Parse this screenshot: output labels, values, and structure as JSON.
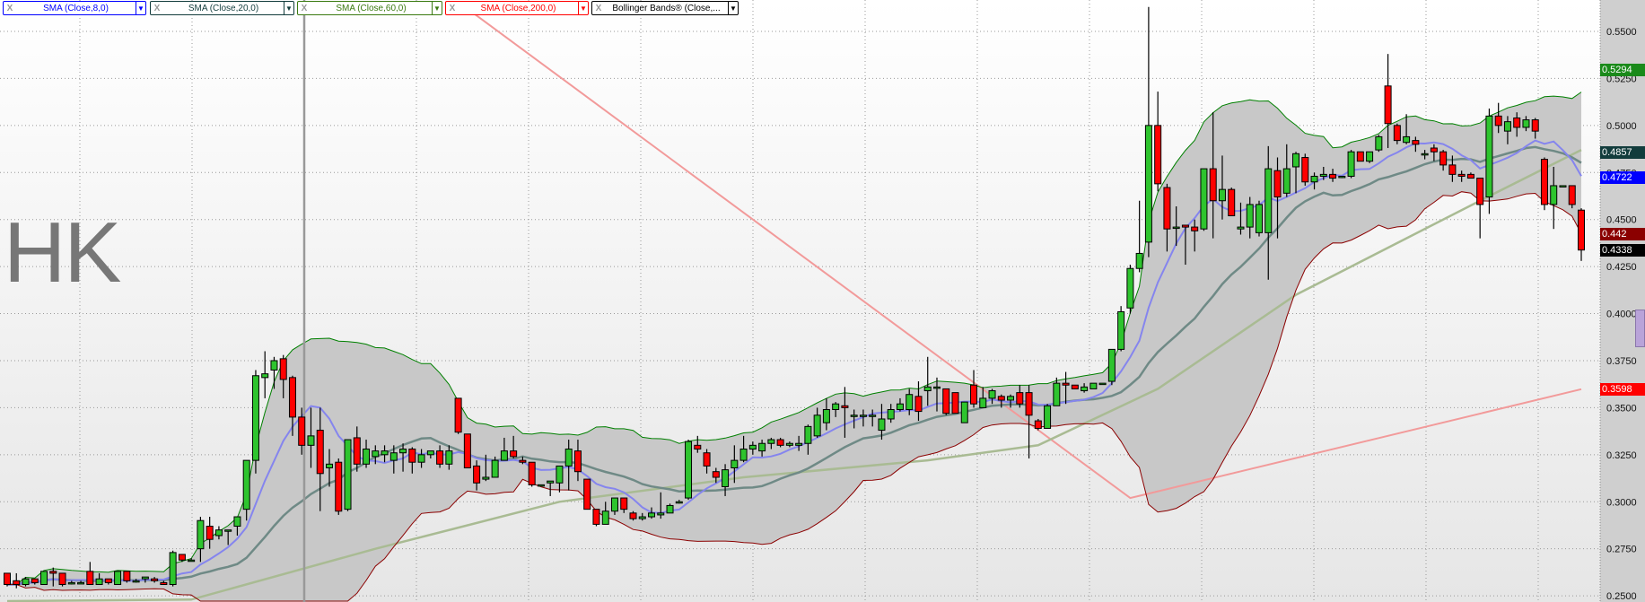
{
  "symbol_watermark": "HK",
  "legend": [
    {
      "close": "X",
      "label": "SMA (Close,8,0)",
      "color": "#0000ff"
    },
    {
      "close": "X",
      "label": "SMA (Close,20,0)",
      "color": "#123c3c"
    },
    {
      "close": "X",
      "label": "SMA (Close,60,0)",
      "color": "#3a7a10"
    },
    {
      "close": "X",
      "label": "SMA (Close,200,0)",
      "color": "#ff0000"
    },
    {
      "close": "X",
      "label": "Bollinger Bands® (Close,...",
      "color": "#000000"
    }
  ],
  "price_tags": [
    {
      "value": "0.5294",
      "color": "#1a8a1a",
      "price": 0.5294
    },
    {
      "value": "0.4857",
      "color": "#123c3c",
      "price": 0.4857
    },
    {
      "value": "0.4722",
      "color": "#0000ff",
      "price": 0.4722
    },
    {
      "value": "0.442",
      "color": "#8b0000",
      "price": 0.442
    },
    {
      "value": "0.4338",
      "color": "#000000",
      "price": 0.4338
    },
    {
      "value": "0.3598",
      "color": "#ff0000",
      "price": 0.3598
    }
  ],
  "chart_data": {
    "type": "candlestick",
    "title": "",
    "ylim": [
      0.25,
      0.56
    ],
    "yticks": [
      "0.5500",
      "0.5250",
      "0.5000",
      "0.4750",
      "0.4500",
      "0.4250",
      "0.4000",
      "0.3750",
      "0.3500",
      "0.3250",
      "0.3000",
      "0.2750",
      "0.2500"
    ],
    "ytick_values": [
      0.55,
      0.525,
      0.5,
      0.475,
      0.45,
      0.425,
      0.4,
      0.375,
      0.35,
      0.325,
      0.3,
      0.275,
      0.25
    ],
    "grid": true,
    "colors": {
      "up": "#2ec42e",
      "down": "#ff0000",
      "sma8": "#7a7aee",
      "sma20": "#6f8a86",
      "sma60": "#a9bb93",
      "sma200": "#f29a9a",
      "bb_upper": "#008000",
      "bb_lower": "#8b0000",
      "bb_fill": "#c8c8c8"
    },
    "ohlc": [
      [
        0.262,
        0.262,
        0.255,
        0.256
      ],
      [
        0.258,
        0.262,
        0.254,
        0.256
      ],
      [
        0.256,
        0.26,
        0.255,
        0.259
      ],
      [
        0.259,
        0.259,
        0.256,
        0.257
      ],
      [
        0.256,
        0.263,
        0.256,
        0.263
      ],
      [
        0.263,
        0.265,
        0.255,
        0.262
      ],
      [
        0.262,
        0.262,
        0.255,
        0.256
      ],
      [
        0.257,
        0.258,
        0.256,
        0.257
      ],
      [
        0.257,
        0.258,
        0.257,
        0.257
      ],
      [
        0.263,
        0.268,
        0.256,
        0.256
      ],
      [
        0.256,
        0.262,
        0.256,
        0.259
      ],
      [
        0.259,
        0.259,
        0.256,
        0.257
      ],
      [
        0.256,
        0.263,
        0.256,
        0.263
      ],
      [
        0.263,
        0.263,
        0.257,
        0.258
      ],
      [
        0.258,
        0.259,
        0.257,
        0.258
      ],
      [
        0.259,
        0.26,
        0.257,
        0.26
      ],
      [
        0.259,
        0.26,
        0.257,
        0.258
      ],
      [
        0.257,
        0.258,
        0.256,
        0.256
      ],
      [
        0.256,
        0.274,
        0.255,
        0.273
      ],
      [
        0.272,
        0.272,
        0.268,
        0.269
      ],
      [
        0.269,
        0.27,
        0.269,
        0.269
      ],
      [
        0.275,
        0.292,
        0.268,
        0.29
      ],
      [
        0.287,
        0.292,
        0.275,
        0.28
      ],
      [
        0.282,
        0.287,
        0.28,
        0.285
      ],
      [
        0.285,
        0.285,
        0.277,
        0.285
      ],
      [
        0.287,
        0.29,
        0.282,
        0.292
      ],
      [
        0.296,
        0.322,
        0.29,
        0.322
      ],
      [
        0.322,
        0.37,
        0.315,
        0.367
      ],
      [
        0.366,
        0.38,
        0.355,
        0.368
      ],
      [
        0.37,
        0.377,
        0.36,
        0.375
      ],
      [
        0.376,
        0.378,
        0.355,
        0.365
      ],
      [
        0.366,
        0.367,
        0.335,
        0.345
      ],
      [
        0.345,
        0.35,
        0.325,
        0.33
      ],
      [
        0.33,
        0.35,
        0.318,
        0.335
      ],
      [
        0.338,
        0.35,
        0.295,
        0.315
      ],
      [
        0.318,
        0.328,
        0.308,
        0.32
      ],
      [
        0.321,
        0.323,
        0.293,
        0.295
      ],
      [
        0.296,
        0.333,
        0.295,
        0.333
      ],
      [
        0.334,
        0.34,
        0.316,
        0.32
      ],
      [
        0.32,
        0.333,
        0.318,
        0.328
      ],
      [
        0.324,
        0.33,
        0.32,
        0.327
      ],
      [
        0.325,
        0.33,
        0.321,
        0.327
      ],
      [
        0.322,
        0.33,
        0.315,
        0.326
      ],
      [
        0.326,
        0.331,
        0.316,
        0.328
      ],
      [
        0.328,
        0.329,
        0.315,
        0.321
      ],
      [
        0.321,
        0.328,
        0.318,
        0.325
      ],
      [
        0.325,
        0.327,
        0.323,
        0.327
      ],
      [
        0.327,
        0.33,
        0.318,
        0.32
      ],
      [
        0.32,
        0.33,
        0.317,
        0.327
      ],
      [
        0.355,
        0.355,
        0.336,
        0.337
      ],
      [
        0.336,
        0.336,
        0.318,
        0.318
      ],
      [
        0.319,
        0.322,
        0.306,
        0.31
      ],
      [
        0.312,
        0.325,
        0.311,
        0.313
      ],
      [
        0.313,
        0.324,
        0.313,
        0.322
      ],
      [
        0.322,
        0.334,
        0.322,
        0.327
      ],
      [
        0.327,
        0.335,
        0.323,
        0.324
      ],
      [
        0.322,
        0.324,
        0.32,
        0.321
      ],
      [
        0.321,
        0.321,
        0.308,
        0.309
      ],
      [
        0.309,
        0.309,
        0.309,
        0.309
      ],
      [
        0.31,
        0.311,
        0.303,
        0.311
      ],
      [
        0.31,
        0.319,
        0.305,
        0.319
      ],
      [
        0.319,
        0.333,
        0.306,
        0.328
      ],
      [
        0.327,
        0.333,
        0.311,
        0.316
      ],
      [
        0.312,
        0.312,
        0.296,
        0.296
      ],
      [
        0.296,
        0.296,
        0.287,
        0.288
      ],
      [
        0.288,
        0.3,
        0.288,
        0.295
      ],
      [
        0.295,
        0.302,
        0.293,
        0.302
      ],
      [
        0.302,
        0.302,
        0.294,
        0.296
      ],
      [
        0.294,
        0.295,
        0.29,
        0.291
      ],
      [
        0.291,
        0.294,
        0.29,
        0.292
      ],
      [
        0.292,
        0.297,
        0.291,
        0.294
      ],
      [
        0.293,
        0.305,
        0.291,
        0.294
      ],
      [
        0.294,
        0.299,
        0.294,
        0.298
      ],
      [
        0.3,
        0.301,
        0.299,
        0.3
      ],
      [
        0.302,
        0.333,
        0.301,
        0.332
      ],
      [
        0.33,
        0.335,
        0.326,
        0.328
      ],
      [
        0.326,
        0.328,
        0.315,
        0.319
      ],
      [
        0.316,
        0.318,
        0.31,
        0.313
      ],
      [
        0.308,
        0.32,
        0.303,
        0.317
      ],
      [
        0.318,
        0.33,
        0.31,
        0.322
      ],
      [
        0.322,
        0.335,
        0.321,
        0.328
      ],
      [
        0.328,
        0.332,
        0.325,
        0.33
      ],
      [
        0.327,
        0.333,
        0.324,
        0.331
      ],
      [
        0.331,
        0.334,
        0.328,
        0.333
      ],
      [
        0.333,
        0.334,
        0.329,
        0.33
      ],
      [
        0.33,
        0.332,
        0.329,
        0.331
      ],
      [
        0.33,
        0.335,
        0.327,
        0.331
      ],
      [
        0.331,
        0.341,
        0.325,
        0.34
      ],
      [
        0.335,
        0.35,
        0.334,
        0.346
      ],
      [
        0.342,
        0.355,
        0.338,
        0.349
      ],
      [
        0.349,
        0.353,
        0.345,
        0.352
      ],
      [
        0.351,
        0.361,
        0.334,
        0.35
      ],
      [
        0.346,
        0.349,
        0.339,
        0.346
      ],
      [
        0.346,
        0.349,
        0.34,
        0.346
      ],
      [
        0.346,
        0.349,
        0.34,
        0.346
      ],
      [
        0.338,
        0.352,
        0.333,
        0.344
      ],
      [
        0.344,
        0.352,
        0.342,
        0.349
      ],
      [
        0.349,
        0.355,
        0.348,
        0.352
      ],
      [
        0.349,
        0.36,
        0.346,
        0.357
      ],
      [
        0.356,
        0.364,
        0.343,
        0.348
      ],
      [
        0.359,
        0.377,
        0.351,
        0.361
      ],
      [
        0.361,
        0.366,
        0.348,
        0.361
      ],
      [
        0.36,
        0.36,
        0.346,
        0.347
      ],
      [
        0.358,
        0.358,
        0.347,
        0.347
      ],
      [
        0.342,
        0.353,
        0.342,
        0.353
      ],
      [
        0.362,
        0.37,
        0.35,
        0.352
      ],
      [
        0.35,
        0.361,
        0.35,
        0.355
      ],
      [
        0.355,
        0.36,
        0.352,
        0.359
      ],
      [
        0.356,
        0.357,
        0.35,
        0.354
      ],
      [
        0.354,
        0.357,
        0.35,
        0.356
      ],
      [
        0.358,
        0.362,
        0.35,
        0.352
      ],
      [
        0.358,
        0.362,
        0.323,
        0.346
      ],
      [
        0.343,
        0.344,
        0.338,
        0.339
      ],
      [
        0.339,
        0.352,
        0.339,
        0.351
      ],
      [
        0.351,
        0.366,
        0.351,
        0.363
      ],
      [
        0.363,
        0.369,
        0.352,
        0.362
      ],
      [
        0.362,
        0.362,
        0.36,
        0.36
      ],
      [
        0.359,
        0.363,
        0.358,
        0.361
      ],
      [
        0.36,
        0.363,
        0.36,
        0.363
      ],
      [
        0.363,
        0.363,
        0.363,
        0.363
      ],
      [
        0.364,
        0.381,
        0.362,
        0.381
      ],
      [
        0.381,
        0.404,
        0.38,
        0.401
      ],
      [
        0.403,
        0.426,
        0.4,
        0.424
      ],
      [
        0.424,
        0.46,
        0.422,
        0.432
      ],
      [
        0.438,
        0.563,
        0.43,
        0.5
      ],
      [
        0.5,
        0.518,
        0.465,
        0.469
      ],
      [
        0.467,
        0.469,
        0.433,
        0.445
      ],
      [
        0.446,
        0.457,
        0.436,
        0.446
      ],
      [
        0.447,
        0.447,
        0.426,
        0.446
      ],
      [
        0.446,
        0.45,
        0.433,
        0.444
      ],
      [
        0.445,
        0.477,
        0.444,
        0.477
      ],
      [
        0.477,
        0.507,
        0.44,
        0.46
      ],
      [
        0.46,
        0.484,
        0.45,
        0.466
      ],
      [
        0.466,
        0.467,
        0.452,
        0.452
      ],
      [
        0.445,
        0.459,
        0.442,
        0.446
      ],
      [
        0.446,
        0.462,
        0.44,
        0.458
      ],
      [
        0.443,
        0.46,
        0.441,
        0.458
      ],
      [
        0.443,
        0.489,
        0.418,
        0.477
      ],
      [
        0.476,
        0.483,
        0.44,
        0.462
      ],
      [
        0.464,
        0.49,
        0.462,
        0.477
      ],
      [
        0.478,
        0.486,
        0.464,
        0.485
      ],
      [
        0.483,
        0.485,
        0.468,
        0.47
      ],
      [
        0.47,
        0.475,
        0.466,
        0.473
      ],
      [
        0.473,
        0.478,
        0.471,
        0.474
      ],
      [
        0.474,
        0.477,
        0.47,
        0.472
      ],
      [
        0.473,
        0.473,
        0.472,
        0.473
      ],
      [
        0.473,
        0.487,
        0.472,
        0.486
      ],
      [
        0.486,
        0.486,
        0.481,
        0.481
      ],
      [
        0.481,
        0.486,
        0.48,
        0.486
      ],
      [
        0.487,
        0.495,
        0.486,
        0.494
      ],
      [
        0.521,
        0.538,
        0.488,
        0.501
      ],
      [
        0.5,
        0.501,
        0.49,
        0.492
      ],
      [
        0.491,
        0.506,
        0.49,
        0.494
      ],
      [
        0.492,
        0.494,
        0.486,
        0.49
      ],
      [
        0.485,
        0.487,
        0.482,
        0.485
      ],
      [
        0.488,
        0.49,
        0.481,
        0.486
      ],
      [
        0.486,
        0.487,
        0.476,
        0.479
      ],
      [
        0.479,
        0.484,
        0.47,
        0.474
      ],
      [
        0.474,
        0.476,
        0.47,
        0.473
      ],
      [
        0.474,
        0.475,
        0.472,
        0.472
      ],
      [
        0.472,
        0.472,
        0.44,
        0.458
      ],
      [
        0.462,
        0.509,
        0.453,
        0.505
      ],
      [
        0.505,
        0.512,
        0.496,
        0.5
      ],
      [
        0.497,
        0.505,
        0.49,
        0.502
      ],
      [
        0.504,
        0.507,
        0.494,
        0.499
      ],
      [
        0.499,
        0.505,
        0.497,
        0.503
      ],
      [
        0.503,
        0.504,
        0.493,
        0.497
      ],
      [
        0.482,
        0.483,
        0.455,
        0.458
      ],
      [
        0.458,
        0.478,
        0.445,
        0.468
      ],
      [
        0.468,
        0.468,
        0.468,
        0.468
      ],
      [
        0.468,
        0.468,
        0.456,
        0.458
      ],
      [
        0.455,
        0.456,
        0.428,
        0.4338
      ]
    ],
    "sma60_points": [
      [
        0,
        0.24
      ],
      [
        20,
        0.248
      ],
      [
        40,
        0.275
      ],
      [
        60,
        0.3
      ],
      [
        80,
        0.313
      ],
      [
        100,
        0.322
      ],
      [
        112,
        0.33
      ],
      [
        125,
        0.36
      ],
      [
        140,
        0.41
      ],
      [
        160,
        0.46
      ],
      [
        171,
        0.487
      ]
    ],
    "sma200_points": [
      [
        50,
        0.562
      ],
      [
        122,
        0.302
      ],
      [
        171,
        0.3598
      ]
    ]
  }
}
